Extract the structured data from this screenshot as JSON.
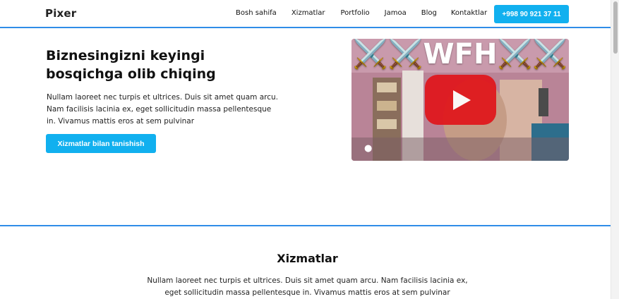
{
  "header": {
    "logo": "Pixer",
    "nav": [
      "Bosh sahifa",
      "Xizmatlar",
      "Portfolio",
      "Jamoa",
      "Blog",
      "Kontaktlar"
    ],
    "phone": "+998 90 921 37 11"
  },
  "hero": {
    "title": "Biznesingizni keyingi bosqichga olib chiqing",
    "text": "Nullam laoreet nec turpis et ultrices. Duis sit amet quam arcu. Nam facilisis lacinia ex, eget sollicitudin massa pellentesque in. Vivamus mattis eros at sem pulvinar",
    "cta": "Xizmatlar bilan tanishish",
    "video_overlay": "⚔️⚔️WFH⚔️⚔️"
  },
  "services": {
    "title": "Xizmatlar",
    "text": "Nullam laoreet nec turpis et ultrices. Duis sit amet quam arcu. Nam facilisis lacinia ex, eget sollicitudin massa pellentesque in. Vivamus mattis eros at sem pulvinar"
  },
  "colors": {
    "accent": "#11b0ef",
    "hero_border": "#2f8de8",
    "play_button": "#e0161b"
  }
}
